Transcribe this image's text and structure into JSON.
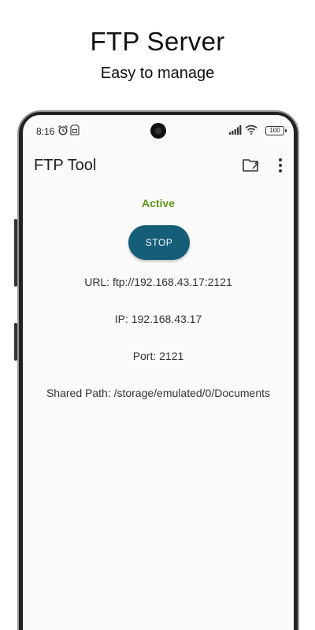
{
  "promo": {
    "title": "FTP Server",
    "subtitle": "Easy to manage"
  },
  "status_bar": {
    "time": "8:16",
    "battery": "100",
    "icons": [
      "alarm-icon",
      "sim-icon",
      "signal-icon",
      "wifi-icon",
      "battery-icon"
    ]
  },
  "app_bar": {
    "title": "FTP Tool",
    "actions": [
      "folder-settings-icon",
      "more-vert-icon"
    ]
  },
  "server": {
    "status": "Active",
    "status_color": "#5a9a14",
    "button_label": "STOP",
    "button_color": "#155e78",
    "url_line": "URL: ftp://192.168.43.17:2121",
    "ip_line": "IP: 192.168.43.17",
    "port_line": "Port: 2121",
    "path_line": "Shared Path: /storage/emulated/0/Documents"
  }
}
